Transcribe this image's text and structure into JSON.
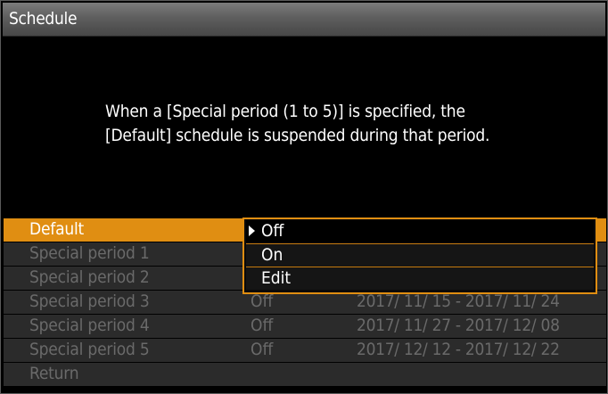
{
  "window": {
    "title": "Schedule"
  },
  "message": {
    "line1": "When a [Special period (1 to 5)] is specified, the",
    "line2": "[Default] schedule is suspended during that period."
  },
  "rows": [
    {
      "name": "Default",
      "state": "",
      "period": ""
    },
    {
      "name": "Special period 1",
      "state": "",
      "period": ""
    },
    {
      "name": "Special period 2",
      "state": "",
      "period": ""
    },
    {
      "name": "Special period 3",
      "state": "Off",
      "period": "2017/ 11/ 15 - 2017/ 11/ 24"
    },
    {
      "name": "Special period 4",
      "state": "Off",
      "period": "2017/ 11/ 27 - 2017/ 12/ 08"
    },
    {
      "name": "Special period 5",
      "state": "Off",
      "period": "2017/ 12/ 12 - 2017/ 12/ 22"
    },
    {
      "name": "Return",
      "state": "",
      "period": ""
    }
  ],
  "dropdown": {
    "options": [
      "Off",
      "On",
      "Edit"
    ],
    "selected": "Off"
  },
  "colors": {
    "accent": "#e08e12",
    "row_bg": "#2b2b2b",
    "disabled_text": "#6a6a6a"
  }
}
